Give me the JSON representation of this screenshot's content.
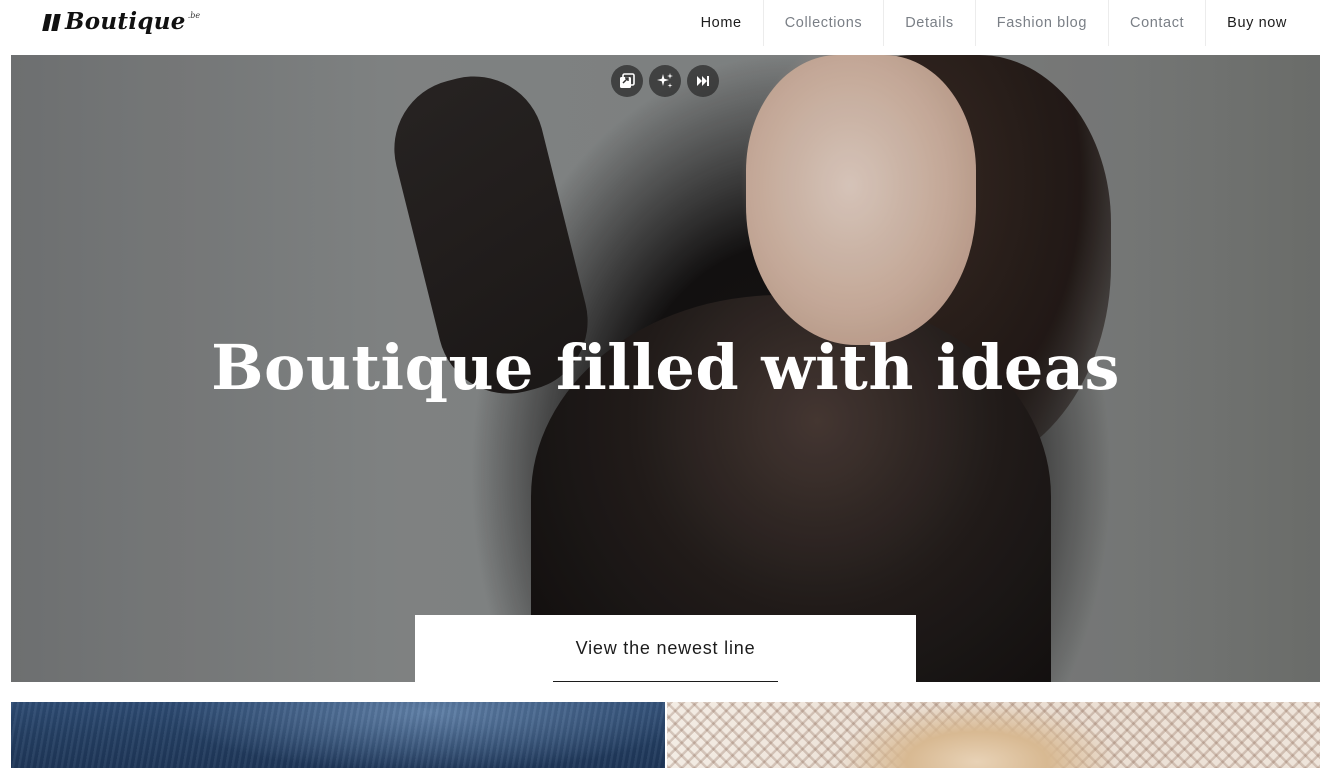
{
  "header": {
    "logo": {
      "name": "Boutique",
      "tld": ".be"
    },
    "nav": [
      {
        "label": "Home"
      },
      {
        "label": "Collections"
      },
      {
        "label": "Details"
      },
      {
        "label": "Fashion blog"
      },
      {
        "label": "Contact"
      },
      {
        "label": "Buy now"
      }
    ]
  },
  "hero": {
    "title": "Boutique filled with ideas",
    "cta_label": "View the newest line",
    "tools": [
      {
        "icon": "image-copy-icon"
      },
      {
        "icon": "sparkle-icon"
      },
      {
        "icon": "skip-next-icon"
      }
    ]
  },
  "tiles": [
    {
      "icon": "denim-image"
    },
    {
      "icon": "blonde-portrait-image"
    }
  ],
  "colors": {
    "text_dark": "#1c1c1c",
    "nav_muted": "#7a7f86",
    "white": "#ffffff"
  }
}
